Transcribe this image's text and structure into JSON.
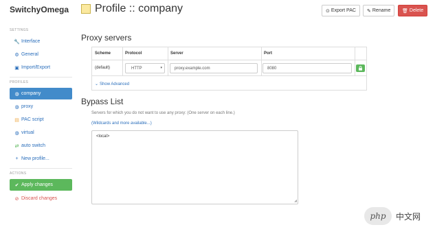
{
  "app": {
    "title": "SwitchyOmega"
  },
  "sidebar": {
    "settings_header": "SETTINGS",
    "settings_items": [
      {
        "label": "Interface",
        "icon": "wrench-icon"
      },
      {
        "label": "General",
        "icon": "gear-icon"
      },
      {
        "label": "Import/Export",
        "icon": "floppy-icon"
      }
    ],
    "profiles_header": "PROFILES",
    "profile_items": [
      {
        "label": "company",
        "icon": "globe-icon",
        "active": true
      },
      {
        "label": "proxy",
        "icon": "globe-icon"
      },
      {
        "label": "PAC script",
        "icon": "file-icon"
      },
      {
        "label": "virtual",
        "icon": "globe-icon"
      },
      {
        "label": "auto switch",
        "icon": "retweet-icon"
      },
      {
        "label": "New profile...",
        "icon": "plus-icon"
      }
    ],
    "actions_header": "ACTIONS",
    "apply_label": "Apply changes",
    "discard_label": "Discard changes"
  },
  "header": {
    "title": "Profile :: company",
    "profile_color": "#fbe9a0",
    "export_label": "Export PAC",
    "rename_label": "Rename",
    "delete_label": "Delete"
  },
  "proxy_servers": {
    "title": "Proxy servers",
    "columns": [
      "Scheme",
      "Protocol",
      "Server",
      "Port"
    ],
    "row": {
      "scheme": "(default)",
      "protocol": "HTTP",
      "server": "proxy.example.com",
      "port": "8080"
    },
    "show_advanced": "Show Advanced"
  },
  "bypass": {
    "title": "Bypass List",
    "help": "Servers for which you do not want to use any proxy: (One server on each line.)",
    "wildcards_link": "(Wildcards and more available...)",
    "content": "<local>"
  },
  "watermark": {
    "logo": "php",
    "text": "中文网"
  },
  "colors": {
    "primary": "#428bca",
    "success": "#5cb85c",
    "danger": "#d9534f",
    "link": "#2a6ebb"
  }
}
